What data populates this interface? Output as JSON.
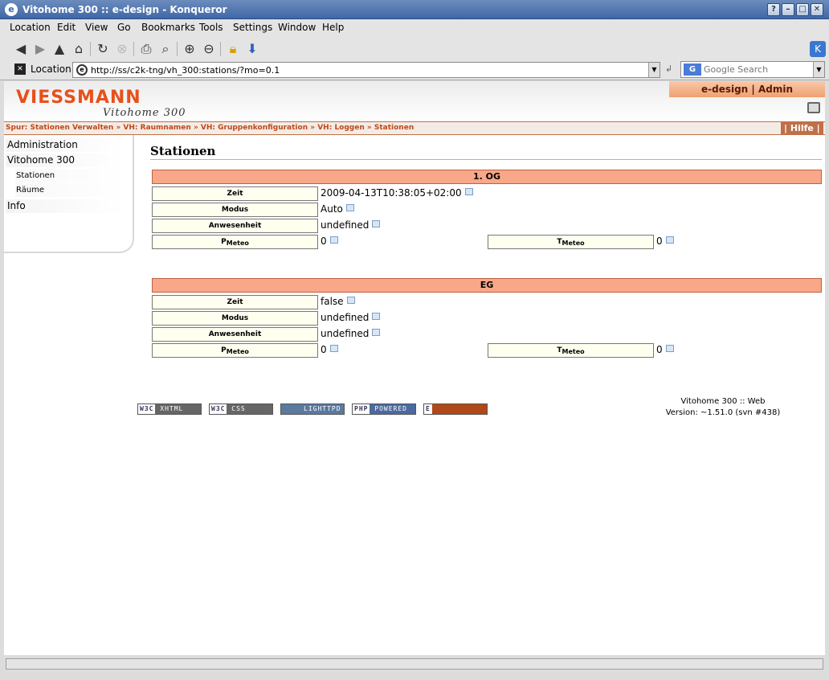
{
  "window": {
    "title": "Vitohome 300 :: e-design - Konqueror"
  },
  "menu": [
    "Location",
    "Edit",
    "View",
    "Go",
    "Bookmarks",
    "Tools",
    "Settings",
    "Window",
    "Help"
  ],
  "locationbar": {
    "label": "Location:",
    "url": "http://ss/c2k-tng/vh_300:stations/?mo=0.1",
    "search_placeholder": "Google Search"
  },
  "header": {
    "logo": "VIESSMANN",
    "sublogo": "Vitohome 300",
    "user": "e-design | Admin"
  },
  "breadcrumb": {
    "prefix": "Spur:",
    "items": [
      "Stationen Verwalten",
      "VH: Raumnamen",
      "VH: Gruppenkonfiguration",
      "VH: Loggen",
      "Stationen"
    ],
    "sep": "»",
    "help": "| Hilfe |"
  },
  "sidebar": [
    "Administration",
    "Vitohome 300",
    "Stationen",
    "Räume",
    "Info"
  ],
  "main": {
    "title": "Stationen",
    "groups": [
      {
        "name": "1. OG",
        "zeit_label": "Zeit",
        "zeit": "2009-04-13T10:38:05+02:00",
        "modus_label": "Modus",
        "modus": "Auto",
        "anw_label": "Anwesenheit",
        "anw": "undefined",
        "p_main": "P",
        "p_sub": "Meteo",
        "p_val": "0",
        "t_main": "T",
        "t_sub": "Meteo",
        "t_val": "0"
      },
      {
        "name": "EG",
        "zeit_label": "Zeit",
        "zeit": "false",
        "modus_label": "Modus",
        "modus": "undefined",
        "anw_label": "Anwesenheit",
        "anw": "undefined",
        "p_main": "P",
        "p_sub": "Meteo",
        "p_val": "0",
        "t_main": "T",
        "t_sub": "Meteo",
        "t_val": "0"
      }
    ]
  },
  "badges": [
    {
      "mark": "W3C",
      "text": "XHTML 1.0"
    },
    {
      "mark": "W3C",
      "text": "CSS"
    },
    {
      "mark": "",
      "text": "LIGHTTPD"
    },
    {
      "mark": "PHP",
      "text": "POWERED"
    },
    {
      "mark": "E",
      "text": "ACCELERATOR"
    }
  ],
  "footer": {
    "line1": "Vitohome 300 :: Web",
    "line2": "Version: ~1.51.0 (svn #438)"
  },
  "colors": {
    "accent": "#e8501a",
    "groupbar": "#f8a888",
    "titlebar": "#3f68a8"
  }
}
